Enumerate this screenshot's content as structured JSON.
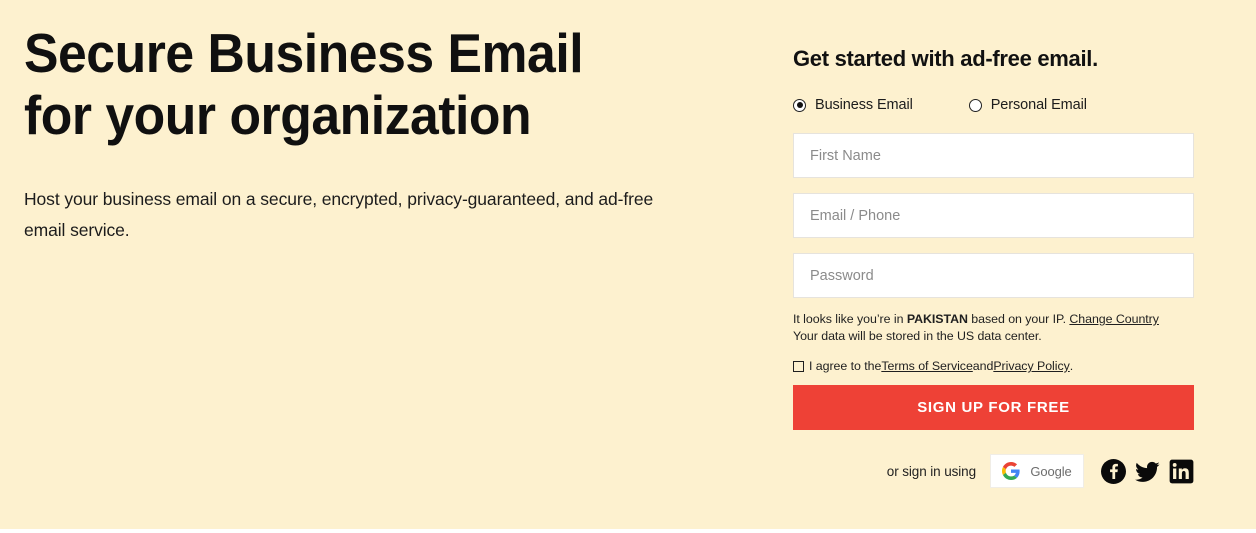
{
  "hero": {
    "headline": "Secure Business Email\nfor your organization",
    "subheadline": "Host your business email on a secure, encrypted, privacy-guaranteed, and ad-free email service."
  },
  "form": {
    "heading": "Get started with ad-free email.",
    "account_type": {
      "options": [
        {
          "label": "Business Email",
          "selected": true
        },
        {
          "label": "Personal Email",
          "selected": false
        }
      ]
    },
    "fields": [
      {
        "name": "first-name",
        "placeholder": "First Name",
        "value": "",
        "type": "text"
      },
      {
        "name": "email-phone",
        "placeholder": "Email / Phone",
        "value": "",
        "type": "text"
      },
      {
        "name": "password",
        "placeholder": "Password",
        "value": "",
        "type": "password"
      }
    ],
    "geo_note": {
      "prefix": "It looks like you’re in ",
      "country": "PAKISTAN",
      "suffix": " based on your IP. ",
      "change_link": "Change Country",
      "data_center_line": "Your data will be stored in the US data center."
    },
    "terms": {
      "checked": false,
      "prefix": "I agree to the ",
      "terms_link": "Terms of Service",
      "middle": " and ",
      "privacy_link": "Privacy Policy",
      "suffix": "."
    },
    "submit_label": "SIGN UP FOR FREE",
    "social": {
      "label": "or sign in using",
      "google_label": "Google",
      "icons": [
        "facebook-icon",
        "twitter-icon",
        "linkedin-icon"
      ]
    }
  },
  "colors": {
    "background": "#fdf1cf",
    "accent_red": "#ee4136",
    "text": "#1c1c1c",
    "placeholder": "#8b8b8b",
    "field_background": "#ffffff"
  }
}
